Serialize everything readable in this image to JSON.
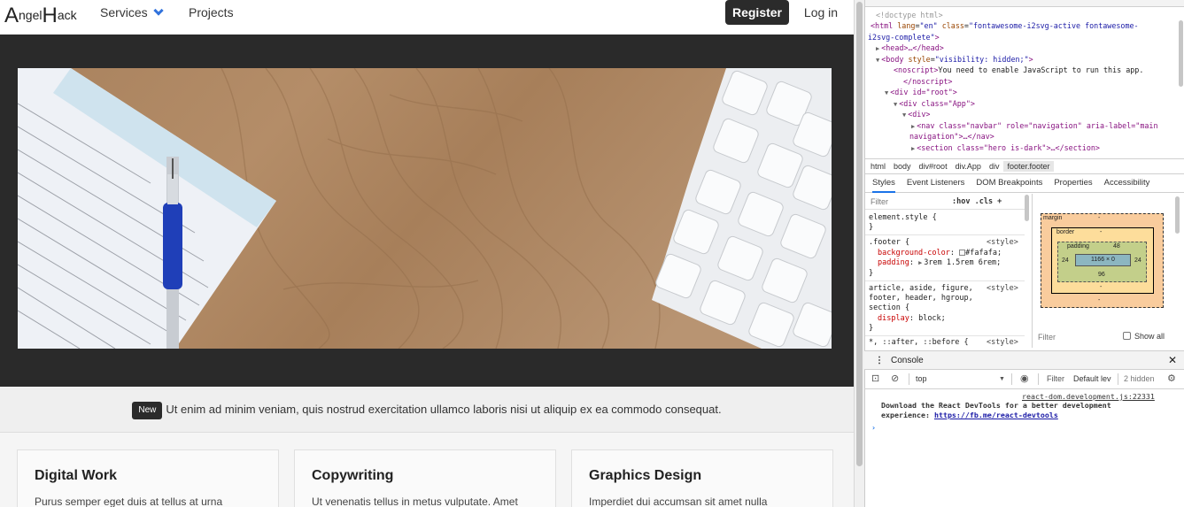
{
  "site": {
    "logo_cap1": "A",
    "logo_rest1": "ngel",
    "logo_cap2": "H",
    "logo_rest2": "ack",
    "nav": {
      "services": "Services",
      "projects": "Projects"
    },
    "register": "Register",
    "login": "Log in",
    "announce": {
      "tag": "New",
      "text": "Ut enim ad minim veniam, quis nostrud exercitation ullamco laboris nisi ut aliquip ex ea commodo consequat."
    },
    "cards": [
      {
        "title": "Digital Work",
        "text": "Purus semper eget duis at tellus at urna"
      },
      {
        "title": "Copywriting",
        "text": "Ut venenatis tellus in metus vulputate. Amet"
      },
      {
        "title": "Graphics Design",
        "text": "Imperdiet dui accumsan sit amet nulla"
      }
    ],
    "colors": {
      "dark": "#2b2b2b",
      "accent": "#3273dc",
      "section_bg": "#f5f5f5"
    }
  },
  "devtools": {
    "dom_tree": {
      "doctype": "<!doctype html>",
      "html_open_1": "<html",
      "html_attr_lang": "lang",
      "html_val_lang": "\"en\"",
      "html_attr_class": "class",
      "html_val_class_1": "\"fontawesome-i2svg-active fontawesome-",
      "html_val_class_2": "i2svg-complete\"",
      "html_close": ">",
      "head": "<head>…</head>",
      "body_open": "<body",
      "body_attr": "style",
      "body_val": "\"visibility: hidden;\"",
      "noscript_open": "<noscript>",
      "noscript_text": "You need to enable JavaScript to run this app.",
      "noscript_close": "</noscript>",
      "div_root": "<div id=\"root\">",
      "div_app": "<div class=\"App\">",
      "div_plain": "<div>",
      "nav_line_1": "<nav class=\"navbar\" role=\"navigation\" aria-label=\"main",
      "nav_line_2": "navigation\">…</nav>",
      "section_line": "<section class=\"hero is-dark\">…</section>"
    },
    "breadcrumbs": [
      "html",
      "body",
      "div#root",
      "div.App",
      "div",
      "footer.footer"
    ],
    "panel_tabs": [
      "Styles",
      "Event Listeners",
      "DOM Breakpoints",
      "Properties",
      "Accessibility"
    ],
    "styles": {
      "filter_placeholder": "Filter",
      "hov_cls": ":hov  .cls  +",
      "element_style": "element.style {",
      "close_brace": "}",
      "footer_selector": ".footer {",
      "source_style": "<style>",
      "prop_bg": "background-color",
      "val_bg": "#fafafa;",
      "prop_padding": "padding",
      "val_padding": "3rem 1.5rem 6rem;",
      "article_sel_1": "article, aside, figure,",
      "article_sel_2": "footer, header, hgroup,",
      "article_sel_3": "section {",
      "prop_display": "display",
      "val_display": "block;",
      "universal_sel": "*, ::after, ::before {"
    },
    "box_model": {
      "margin_label": "margin",
      "margin_dash": "-",
      "border_label": "border",
      "border_dash": "-",
      "padding_label": "padding",
      "padding_top": "48",
      "padding_left": "24",
      "padding_right": "24",
      "padding_bottom": "96",
      "content": "1166 × 0",
      "filter": "Filter",
      "show_all": "Show all"
    },
    "console": {
      "title": "Console",
      "context": "top",
      "filter": "Filter",
      "levels": "Default lev",
      "hidden": "2 hidden",
      "source": "react-dom.development.js:22331",
      "message_1": "Download the React DevTools for a better development",
      "message_2": "experience: ",
      "link": "https://fb.me/react-devtools",
      "prompt": "›"
    }
  }
}
